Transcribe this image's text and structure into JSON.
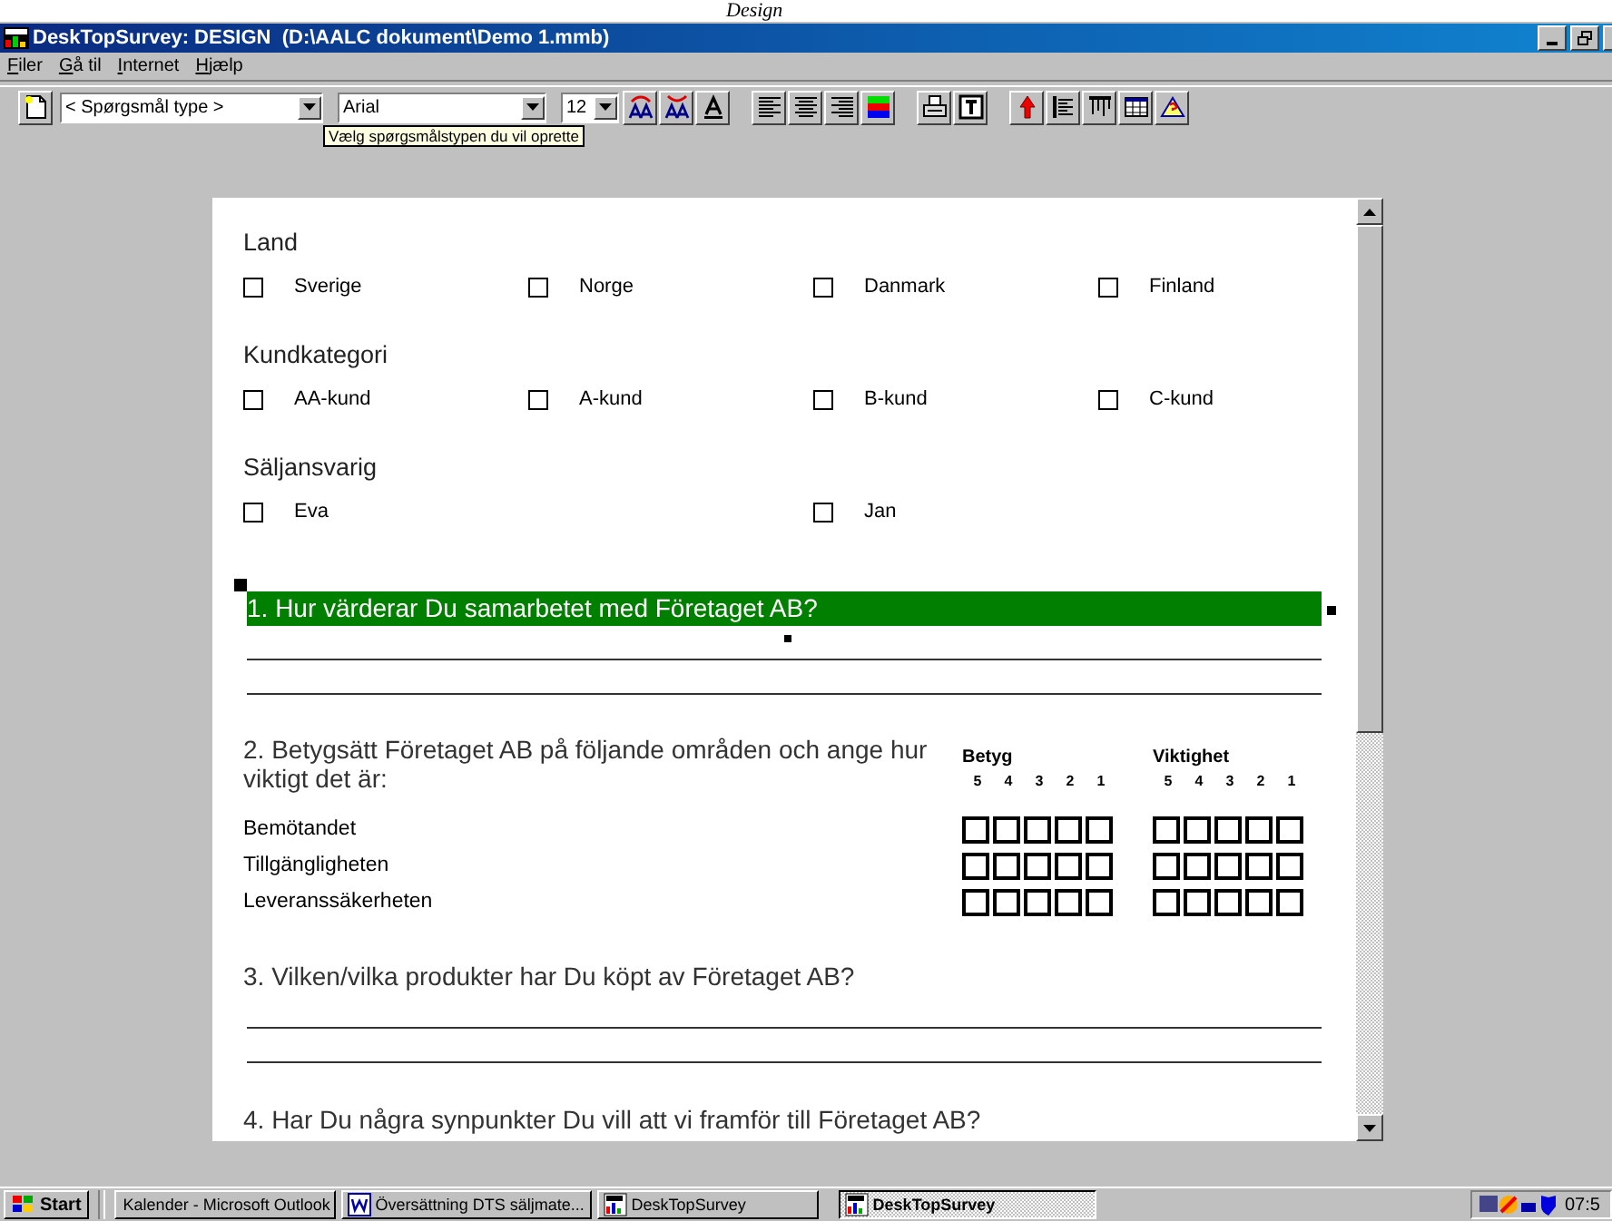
{
  "heading": "Design",
  "window": {
    "title": "DeskTopSurvey: DESIGN  (D:\\AALC dokument\\Demo 1.mmb)"
  },
  "menu": [
    "Filer",
    "Gå til",
    "Internet",
    "Hjælp"
  ],
  "toolbar": {
    "question_type": "< Spørgsmål type >",
    "font": "Arial",
    "size": "12"
  },
  "tooltip": "Vælg spørgsmålstypen du vil oprette",
  "groups": [
    {
      "title": "Land",
      "options": [
        {
          "label": "Sverige",
          "checked": false
        },
        {
          "label": "Norge",
          "checked": false
        },
        {
          "label": "Danmark",
          "checked": false
        },
        {
          "label": "Finland",
          "checked": false
        }
      ]
    },
    {
      "title": "Kundkategori",
      "options": [
        {
          "label": "AA-kund",
          "checked": false
        },
        {
          "label": "A-kund",
          "checked": false
        },
        {
          "label": "B-kund",
          "checked": false
        },
        {
          "label": "C-kund",
          "checked": false
        }
      ]
    },
    {
      "title": "Säljansvarig",
      "options": [
        {
          "label": "Eva",
          "checked": false
        },
        {
          "label": "Jan",
          "checked": false
        }
      ]
    }
  ],
  "questions": [
    {
      "kind": "text",
      "text": "1. Hur värderar Du samarbetet med Företaget AB?",
      "selected": true
    },
    {
      "kind": "rating",
      "text": "2. Betygsätt Företaget AB på följande områden och ange hur viktigt det är:",
      "selected": false,
      "scales": [
        {
          "title": "Betyg",
          "points": [
            "5",
            "4",
            "3",
            "2",
            "1"
          ]
        },
        {
          "title": "Viktighet",
          "points": [
            "5",
            "4",
            "3",
            "2",
            "1"
          ]
        }
      ],
      "rows": [
        {
          "label": "Bemötandet",
          "checked": [
            [
              false,
              false,
              false,
              false,
              false
            ],
            [
              false,
              false,
              false,
              false,
              false
            ]
          ]
        },
        {
          "label": "Tillgängligheten",
          "checked": [
            [
              false,
              false,
              false,
              false,
              false
            ],
            [
              false,
              false,
              false,
              false,
              false
            ]
          ]
        },
        {
          "label": "Leveranssäkerheten",
          "checked": [
            [
              false,
              false,
              false,
              false,
              false
            ],
            [
              false,
              false,
              false,
              false,
              false
            ]
          ]
        }
      ]
    },
    {
      "kind": "text",
      "text": "3. Vilken/vilka produkter har Du köpt av Företaget AB?",
      "selected": false
    },
    {
      "kind": "text",
      "text": "4. Har Du några synpunkter Du vill att vi framför till Företaget AB?",
      "selected": false
    }
  ],
  "taskbar": {
    "start": "Start",
    "tasks": [
      {
        "label": "Kalender - Microsoft Outlook",
        "selected": false
      },
      {
        "label": "Översättning DTS säljmate...",
        "selected": false
      },
      {
        "label": "DeskTopSurvey",
        "selected": false
      },
      {
        "label": "DeskTopSurvey",
        "selected": true
      }
    ],
    "clock": "07:5"
  }
}
